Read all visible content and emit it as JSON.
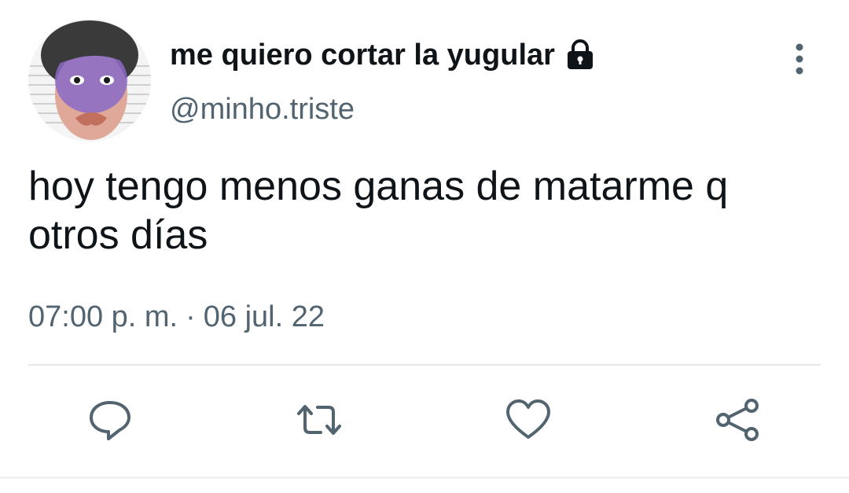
{
  "user": {
    "display_name": "me quiero cortar la yugular",
    "handle": "@minho.triste",
    "avatar_icon": "avatar-face",
    "protected_icon": "lock-icon"
  },
  "tweet": {
    "text": "hoy tengo menos ganas de matarme q otros días",
    "time": "07:00 p. m.",
    "separator": "·",
    "date": "06 jul. 22"
  },
  "actions": {
    "reply_icon": "reply-icon",
    "retweet_icon": "retweet-icon",
    "like_icon": "heart-icon",
    "share_icon": "share-icon"
  },
  "colors": {
    "text_primary": "#0f1419",
    "text_secondary": "#536471",
    "icon": "#536471",
    "divider": "#e6e9eb"
  }
}
